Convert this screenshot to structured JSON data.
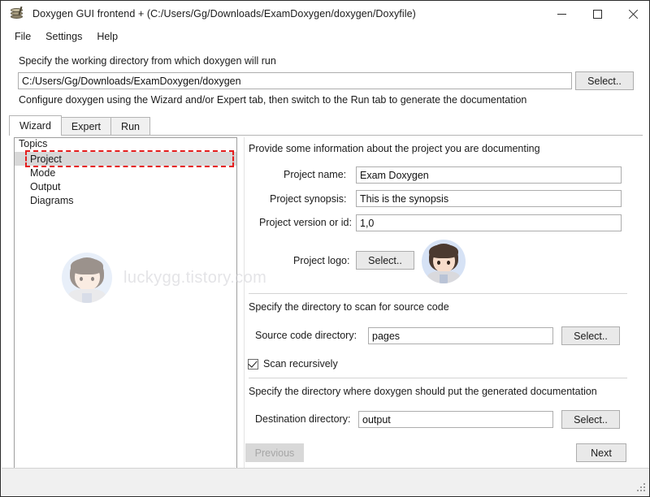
{
  "window": {
    "title": "Doxygen GUI frontend + (C:/Users/Gg/Downloads/ExamDoxygen/doxygen/Doxyfile)",
    "app_icon": "doxygen-stack-icon",
    "controls": {
      "minimize": "minimize-icon",
      "maximize": "maximize-icon",
      "close": "close-icon"
    }
  },
  "menubar": {
    "items": [
      {
        "label": "File"
      },
      {
        "label": "Settings"
      },
      {
        "label": "Help"
      }
    ]
  },
  "workdir": {
    "label": "Specify the working directory from which doxygen will run",
    "value": "C:/Users/Gg/Downloads/ExamDoxygen/doxygen",
    "placeholder": "",
    "select_label": "Select..",
    "hint": "Configure doxygen using the Wizard and/or Expert tab, then switch to the Run tab to generate the documentation"
  },
  "tabs": [
    {
      "label": "Wizard",
      "active": true
    },
    {
      "label": "Expert",
      "active": false
    },
    {
      "label": "Run",
      "active": false
    }
  ],
  "topics": {
    "title": "Topics",
    "items": [
      {
        "label": "Project",
        "selected": true,
        "annotated": true
      },
      {
        "label": "Mode",
        "selected": false,
        "annotated": false
      },
      {
        "label": "Output",
        "selected": false,
        "annotated": false
      },
      {
        "label": "Diagrams",
        "selected": false,
        "annotated": false
      }
    ],
    "annotation_color": "#e51d1d"
  },
  "watermark": {
    "text": "luckygg.tistory.com"
  },
  "project_section": {
    "heading": "Provide some information about the project you are documenting",
    "name_label": "Project name:",
    "name_value": "Exam Doxygen",
    "synopsis_label": "Project synopsis:",
    "synopsis_value": "This is the synopsis",
    "version_label": "Project version or id:",
    "version_value": "1,0",
    "logo_label": "Project logo:",
    "logo_button": "Select..",
    "logo_preview": "avatar-image"
  },
  "source_section": {
    "heading": "Specify the directory to scan for source code",
    "dir_label": "Source code directory:",
    "dir_value": "pages",
    "select_label": "Select..",
    "scan_recursively_label": "Scan recursively",
    "scan_recursively_checked": true
  },
  "dest_section": {
    "heading": "Specify the directory where doxygen should put the generated documentation",
    "dir_label": "Destination directory:",
    "dir_value": "output",
    "select_label": "Select.."
  },
  "nav": {
    "previous_label": "Previous",
    "previous_enabled": false,
    "next_label": "Next",
    "next_enabled": true
  }
}
